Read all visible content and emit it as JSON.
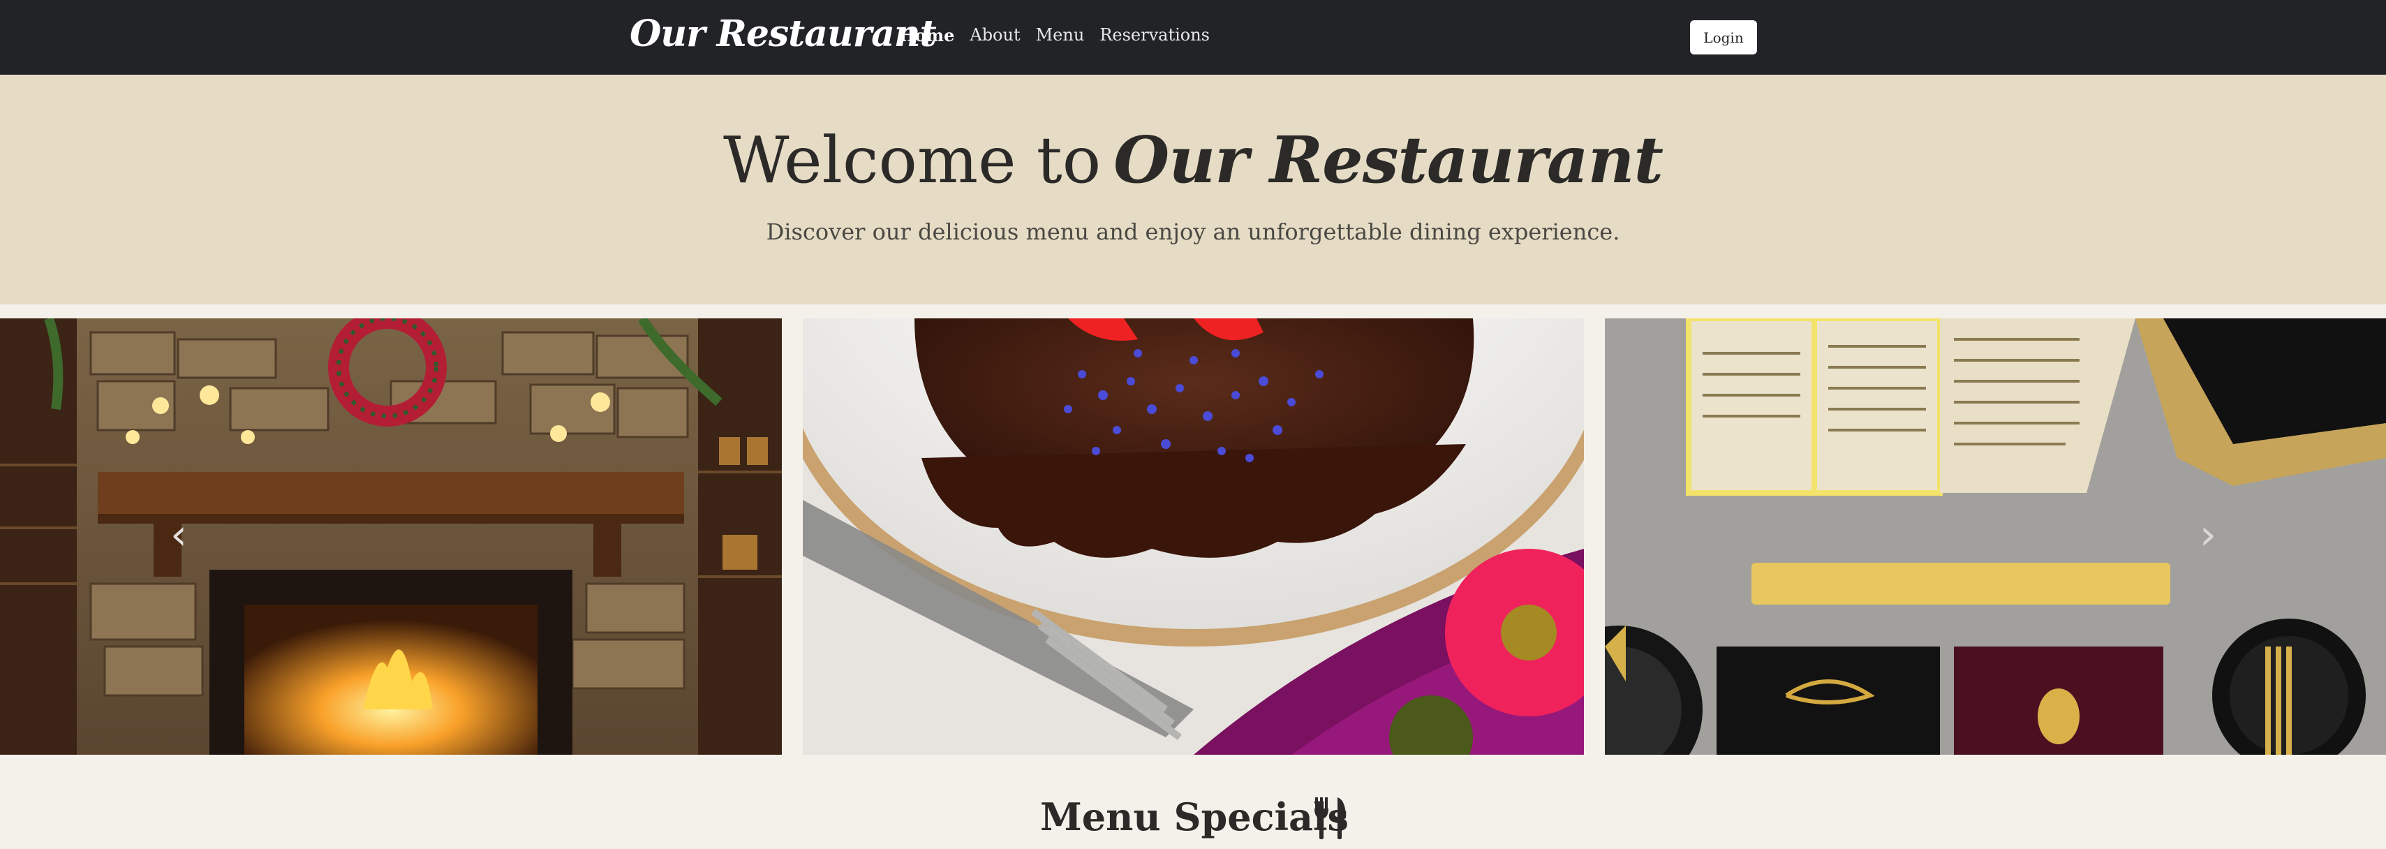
{
  "nav": {
    "brand": "Our Restaurant",
    "links": [
      {
        "label": "Home",
        "active": true
      },
      {
        "label": "About"
      },
      {
        "label": "Menu"
      },
      {
        "label": "Reservations"
      }
    ],
    "login_label": "Login"
  },
  "hero": {
    "title_prefix": "Welcome to",
    "title_name": "Our Restaurant",
    "subtitle": "Discover our delicious menu and enjoy an unforgettable dining experience."
  },
  "carousel": {
    "slides": [
      {
        "subject": "fireplace-with-wreath"
      },
      {
        "subject": "chocolate-cake-dessert"
      },
      {
        "subject": "gold-menu-stationery"
      }
    ],
    "prev_icon": "chevron-left-icon",
    "next_icon": "chevron-right-icon"
  },
  "specials": {
    "heading": "Menu Specials",
    "icon": "utensils-icon"
  },
  "colors": {
    "navbar": "#212327",
    "hero_bg": "#e6dcc5",
    "page_bg": "#f4f1ea",
    "text": "#2b2a28"
  }
}
